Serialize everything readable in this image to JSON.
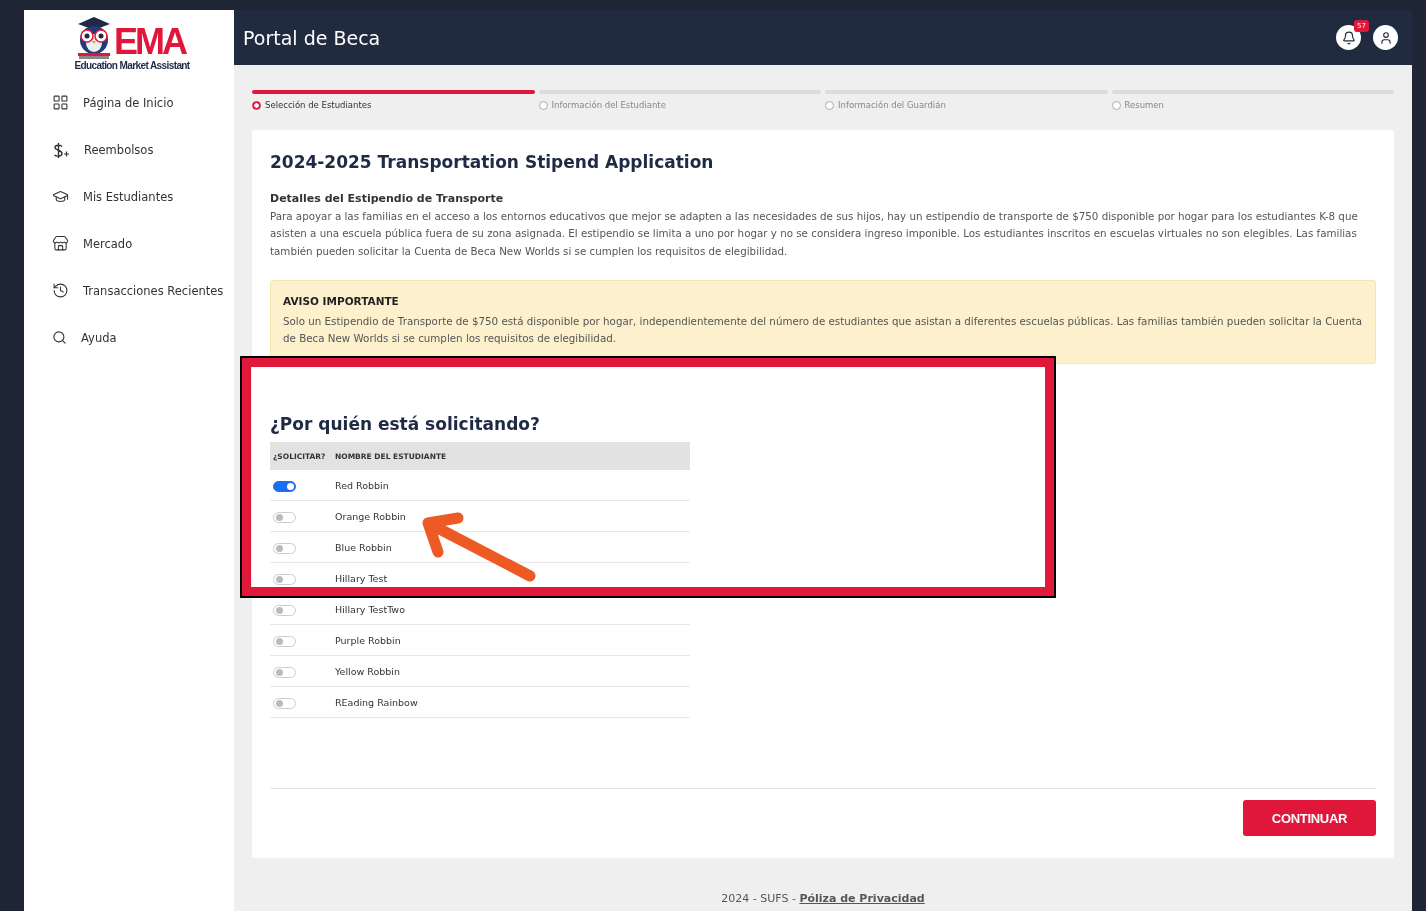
{
  "logo": {
    "mark": "EMA",
    "subtitle": "Education Market Assistant"
  },
  "sidebar": {
    "items": [
      {
        "label": "Página de Inicio"
      },
      {
        "label": "Reembolsos"
      },
      {
        "label": "Mis Estudiantes"
      },
      {
        "label": "Mercado"
      },
      {
        "label": "Transacciones Recientes"
      },
      {
        "label": "Ayuda"
      }
    ]
  },
  "header": {
    "title": "Portal de Beca",
    "notification_count": "57"
  },
  "steps": [
    {
      "label": "Selección de Estudiantes",
      "selected": true
    },
    {
      "label": "Información del Estudiante",
      "selected": false
    },
    {
      "label": "Información del Guardián",
      "selected": false
    },
    {
      "label": "Resumen",
      "selected": false
    }
  ],
  "form": {
    "title": "2024-2025 Transportation Stipend Application",
    "details_heading": "Detalles del Estipendio de Transporte",
    "details_text": "Para apoyar a las familias en el acceso a los entornos educativos que mejor se adapten a las necesidades de sus hijos, hay un estipendio de transporte de $750 disponible por hogar para los estudiantes K-8 que asisten a una escuela pública fuera de su zona asignada. El estipendio se limita a uno por hogar y no se considera ingreso imponible. Los estudiantes inscritos en escuelas virtuales no son elegibles. Las familias también pueden solicitar la Cuenta de Beca New Worlds si se cumplen los requisitos de elegibilidad.",
    "notice": {
      "title": "AVISO IMPORTANTE",
      "text": "Solo un Estipendio de Transporte de $750 está disponible por hogar, independientemente del número de estudiantes que asistan a diferentes escuelas públicas. Las familias también pueden solicitar la Cuenta de Beca New Worlds si se cumplen los requisitos de elegibilidad."
    },
    "question": "¿Por quién está solicitando?",
    "table": {
      "columns": [
        "¿SOLICITAR?",
        "NOMBRE DEL ESTUDIANTE"
      ],
      "rows": [
        {
          "name": "Red Robbin",
          "on": true
        },
        {
          "name": "Orange Robbin",
          "on": false
        },
        {
          "name": "Blue Robbin",
          "on": false
        },
        {
          "name": "Hillary Test",
          "on": false
        },
        {
          "name": "Hillary TestTwo",
          "on": false
        },
        {
          "name": "Purple Robbin",
          "on": false
        },
        {
          "name": "Yellow Robbin",
          "on": false
        },
        {
          "name": "REading Rainbow",
          "on": false
        }
      ]
    },
    "continue_button": "CONTINUAR"
  },
  "footer": {
    "text": "2024 - SUFS - ",
    "link": "Póliza de Privacidad"
  }
}
